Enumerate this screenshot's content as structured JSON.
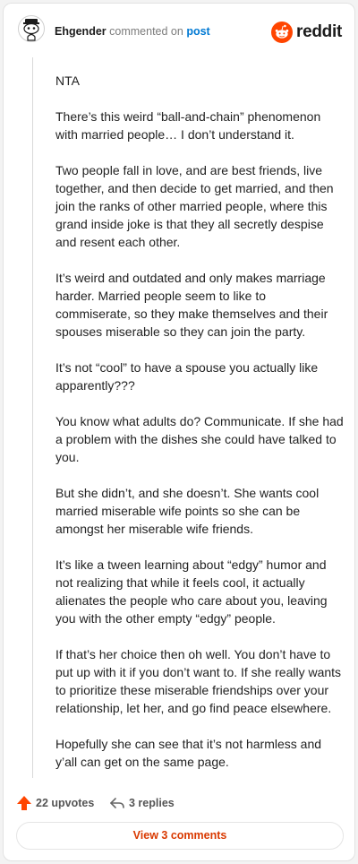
{
  "header": {
    "author": "Ehgender",
    "action": "commented on",
    "post_link": "post",
    "logo_text": "reddit",
    "avatar_icon": "snoo-avatar-icon",
    "brand_color": "#ff4500"
  },
  "comment": {
    "paragraphs": [
      "NTA",
      "There’s this weird “ball-and-chain” phenomenon with married people… I don’t understand it.",
      "Two people fall in love, and are best friends, live together, and then decide to get married, and then join the ranks of other married people, where this grand inside joke is that they all secretly despise and resent each other.",
      "It’s weird and outdated and only makes marriage harder. Married people seem to like to commiserate, so they make themselves and their spouses miserable so they can join the party.",
      "It’s not “cool” to have a spouse you actually like apparently???",
      "You know what adults do? Communicate. If she had a problem with the dishes she could have talked to you.",
      "But she didn’t, and she doesn’t. She wants cool married miserable wife points so she can be amongst her miserable wife friends.",
      "It’s like a tween learning about “edgy” humor and not realizing that while it feels cool, it actually alienates the people who care about you, leaving you with the other empty “edgy” people.",
      "If that’s her choice then oh well. You don’t have to put up with it if you don’t want to. If she really wants to prioritize these miserable friendships over your relationship, let her, and go find peace elsewhere.",
      "Hopefully she can see that it’s not harmless and y’all can get on the same page."
    ]
  },
  "footer": {
    "upvotes": "22 upvotes",
    "replies": "3 replies",
    "view_comments": "View 3 comments",
    "upvote_icon": "upvote-arrow-icon",
    "reply_icon": "reply-arrow-icon",
    "upvote_color": "#ff4500",
    "view_color": "#d93900"
  }
}
